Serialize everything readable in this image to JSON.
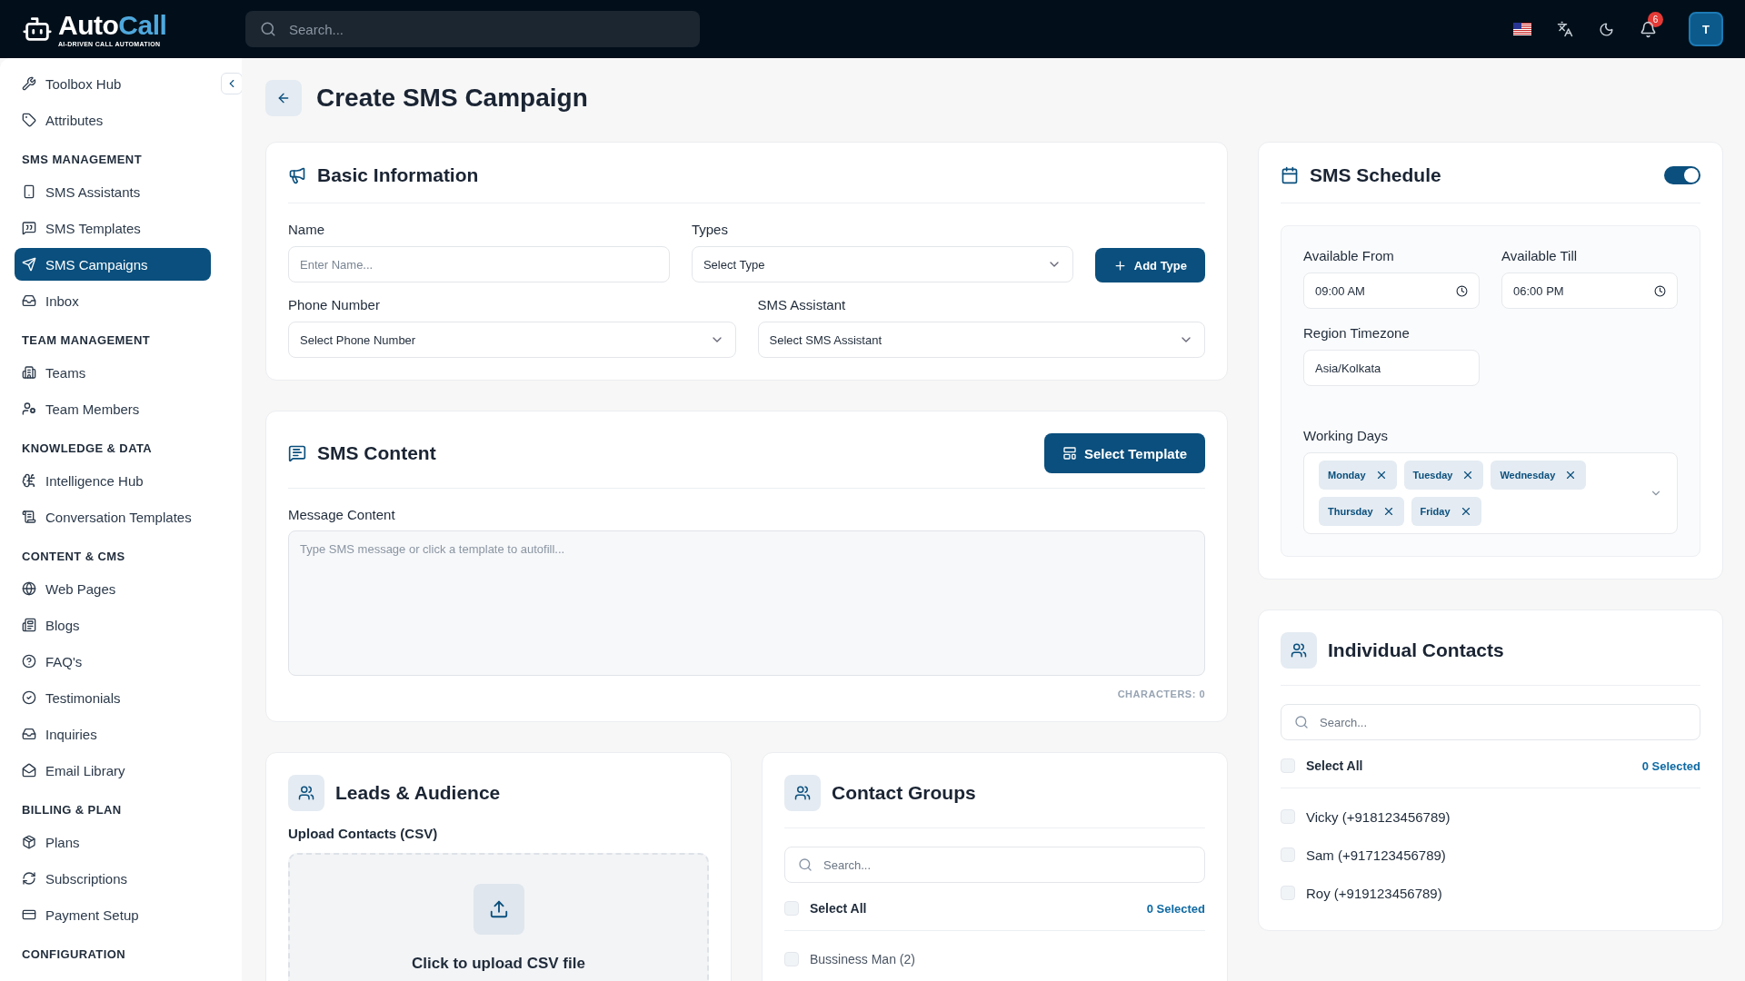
{
  "header": {
    "logo": {
      "first": "Auto",
      "second": "Call",
      "tagline": "AI-DRIVEN CALL AUTOMATION"
    },
    "search": {
      "placeholder": "Search..."
    },
    "notifications": {
      "count": "6"
    },
    "avatar": {
      "initial": "T"
    }
  },
  "sidebar": {
    "items": [
      {
        "kind": "item",
        "label": "Toolbox Hub",
        "selected": false
      },
      {
        "kind": "item",
        "label": "Attributes",
        "selected": false
      },
      {
        "kind": "section",
        "label": "SMS MANAGEMENT"
      },
      {
        "kind": "item",
        "label": "SMS Assistants",
        "selected": false
      },
      {
        "kind": "item",
        "label": "SMS Templates",
        "selected": false
      },
      {
        "kind": "item",
        "label": "SMS Campaigns",
        "selected": true
      },
      {
        "kind": "item",
        "label": "Inbox",
        "selected": false
      },
      {
        "kind": "section",
        "label": "TEAM MANAGEMENT"
      },
      {
        "kind": "item",
        "label": "Teams",
        "selected": false
      },
      {
        "kind": "item",
        "label": "Team Members",
        "selected": false
      },
      {
        "kind": "section",
        "label": "KNOWLEDGE & DATA"
      },
      {
        "kind": "item",
        "label": "Intelligence Hub",
        "selected": false
      },
      {
        "kind": "item",
        "label": "Conversation Templates",
        "selected": false
      },
      {
        "kind": "section",
        "label": "CONTENT & CMS"
      },
      {
        "kind": "item",
        "label": "Web Pages",
        "selected": false
      },
      {
        "kind": "item",
        "label": "Blogs",
        "selected": false
      },
      {
        "kind": "item",
        "label": "FAQ's",
        "selected": false
      },
      {
        "kind": "item",
        "label": "Testimonials",
        "selected": false
      },
      {
        "kind": "item",
        "label": "Inquiries",
        "selected": false
      },
      {
        "kind": "item",
        "label": "Email Library",
        "selected": false
      },
      {
        "kind": "section",
        "label": "BILLING & PLAN"
      },
      {
        "kind": "item",
        "label": "Plans",
        "selected": false
      },
      {
        "kind": "item",
        "label": "Subscriptions",
        "selected": false
      },
      {
        "kind": "item",
        "label": "Payment Setup",
        "selected": false
      },
      {
        "kind": "section",
        "label": "CONFIGURATION"
      }
    ]
  },
  "page": {
    "title": "Create SMS Campaign"
  },
  "basic_information": {
    "title": "Basic Information",
    "add_type_button": "Add Type",
    "fields": [
      {
        "kind": "input",
        "label": "Name",
        "placeholder": "Enter Name..."
      },
      {
        "kind": "select",
        "label": "Types",
        "value": "Select Type"
      },
      {
        "kind": "select",
        "label": "Phone Number",
        "value": "Select Phone Number"
      },
      {
        "kind": "select",
        "label": "SMS Assistant",
        "value": "Select SMS Assistant"
      }
    ]
  },
  "sms_content": {
    "title": "SMS Content",
    "template_button": "Select Template",
    "message_label": "Message Content",
    "message_placeholder": "Type SMS message or click a template to autofill...",
    "characters": "CHARACTERS: 0"
  },
  "leads_audience": {
    "title": "Leads & Audience",
    "upload_label": "Upload Contacts (CSV)",
    "upload_text": "Click to upload CSV file"
  },
  "contact_groups": {
    "title": "Contact Groups",
    "search_placeholder": "Search...",
    "select_all": "Select All",
    "select_all_checked": false,
    "selected_count": "0 Selected",
    "items": [
      {
        "label": "Bussiness Man (2)",
        "checked": false
      }
    ]
  },
  "sms_schedule": {
    "title": "SMS Schedule",
    "on": true,
    "available_from_label": "Available From",
    "available_from": "09:00 AM",
    "available_till_label": "Available Till",
    "available_till": "06:00 PM",
    "timezone_label": "Region Timezone",
    "timezone": "Asia/Kolkata",
    "working_days_label": "Working Days",
    "working_days": [
      "Monday",
      "Tuesday",
      "Wednesday",
      "Thursday",
      "Friday"
    ]
  },
  "individual_contacts": {
    "title": "Individual Contacts",
    "search_placeholder": "Search...",
    "select_all": "Select All",
    "select_all_checked": false,
    "selected_count": "0 Selected",
    "items": [
      {
        "label": "Vicky (+918123456789)",
        "checked": false
      },
      {
        "label": "Sam (+917123456789)",
        "checked": false
      },
      {
        "label": "Roy (+919123456789)",
        "checked": false
      }
    ]
  }
}
